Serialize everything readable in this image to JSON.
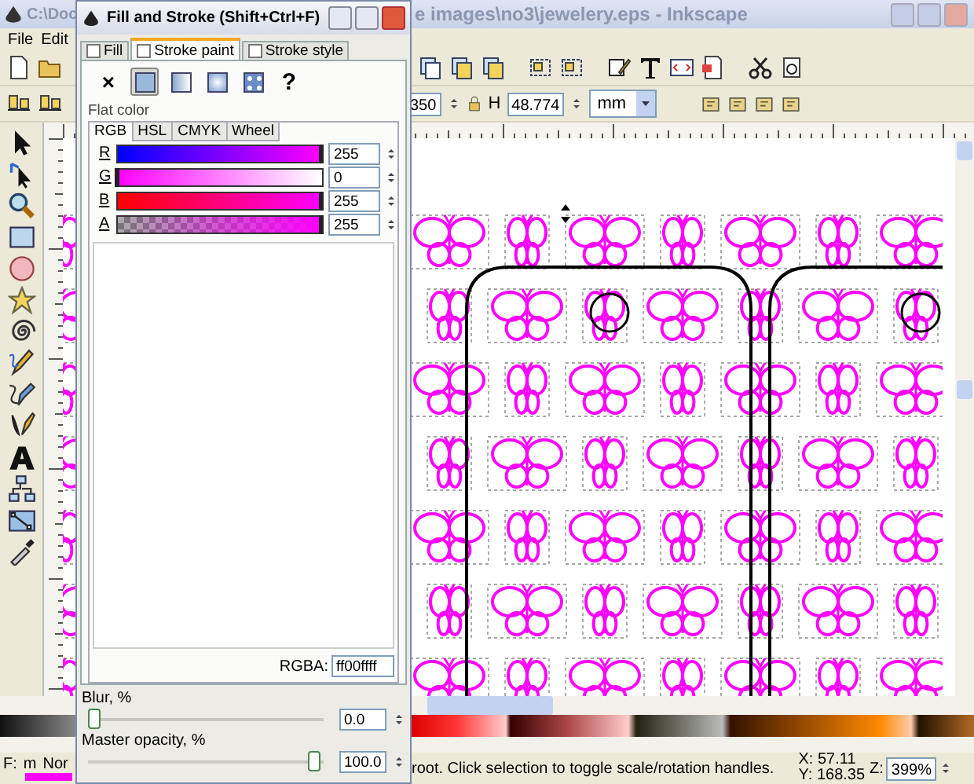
{
  "main_window": {
    "title_left": "C:\\Doc",
    "title_right": "e images\\no3\\jewelery.eps - Inkscape"
  },
  "menu": [
    {
      "label": "File"
    },
    {
      "label": "Edit"
    }
  ],
  "toolbar": {
    "w_value": "350",
    "h_label": "H",
    "h_value": "48.774",
    "unit": "mm"
  },
  "status_bar": {
    "fill_label": "F:",
    "fill_value": "m",
    "blend_mode": "Nor",
    "message": "root. Click selection to toggle scale/rotation handles.",
    "x": "X: 57.11",
    "y": "Y: 168.35",
    "zoom_label": "Z:",
    "zoom": "399%"
  },
  "dialog": {
    "title": "Fill and Stroke (Shift+Ctrl+F)",
    "tabs": [
      {
        "label": "Fill",
        "selected": false
      },
      {
        "label": "Stroke paint",
        "selected": true
      },
      {
        "label": "Stroke style",
        "selected": false
      }
    ],
    "paint_types": [
      {
        "kind": "none",
        "symbol": "×",
        "selected": false
      },
      {
        "kind": "flat",
        "selected": true
      },
      {
        "kind": "linear",
        "selected": false
      },
      {
        "kind": "radial",
        "selected": false
      },
      {
        "kind": "pattern",
        "selected": false
      },
      {
        "kind": "unset",
        "symbol": "?",
        "selected": false
      }
    ],
    "mode_label": "Flat color",
    "color_tabs": [
      {
        "label": "RGB",
        "selected": true
      },
      {
        "label": "HSL",
        "selected": false
      },
      {
        "label": "CMYK",
        "selected": false
      },
      {
        "label": "Wheel",
        "selected": false
      }
    ],
    "channels": [
      {
        "kind": "red",
        "label": "R",
        "value": "255",
        "level": 1
      },
      {
        "kind": "green",
        "label": "G",
        "value": "0",
        "level": 0
      },
      {
        "kind": "blue",
        "label": "B",
        "value": "255",
        "level": 1
      },
      {
        "kind": "alpha",
        "label": "A",
        "value": "255",
        "level": 1
      }
    ],
    "rgba_label": "RGBA:",
    "rgba": "ff00ffff",
    "blur": {
      "label": "Blur, %",
      "value": "0.0",
      "level": 0
    },
    "opacity": {
      "label": "Master opacity, %",
      "value": "100.0",
      "level": 1
    }
  }
}
